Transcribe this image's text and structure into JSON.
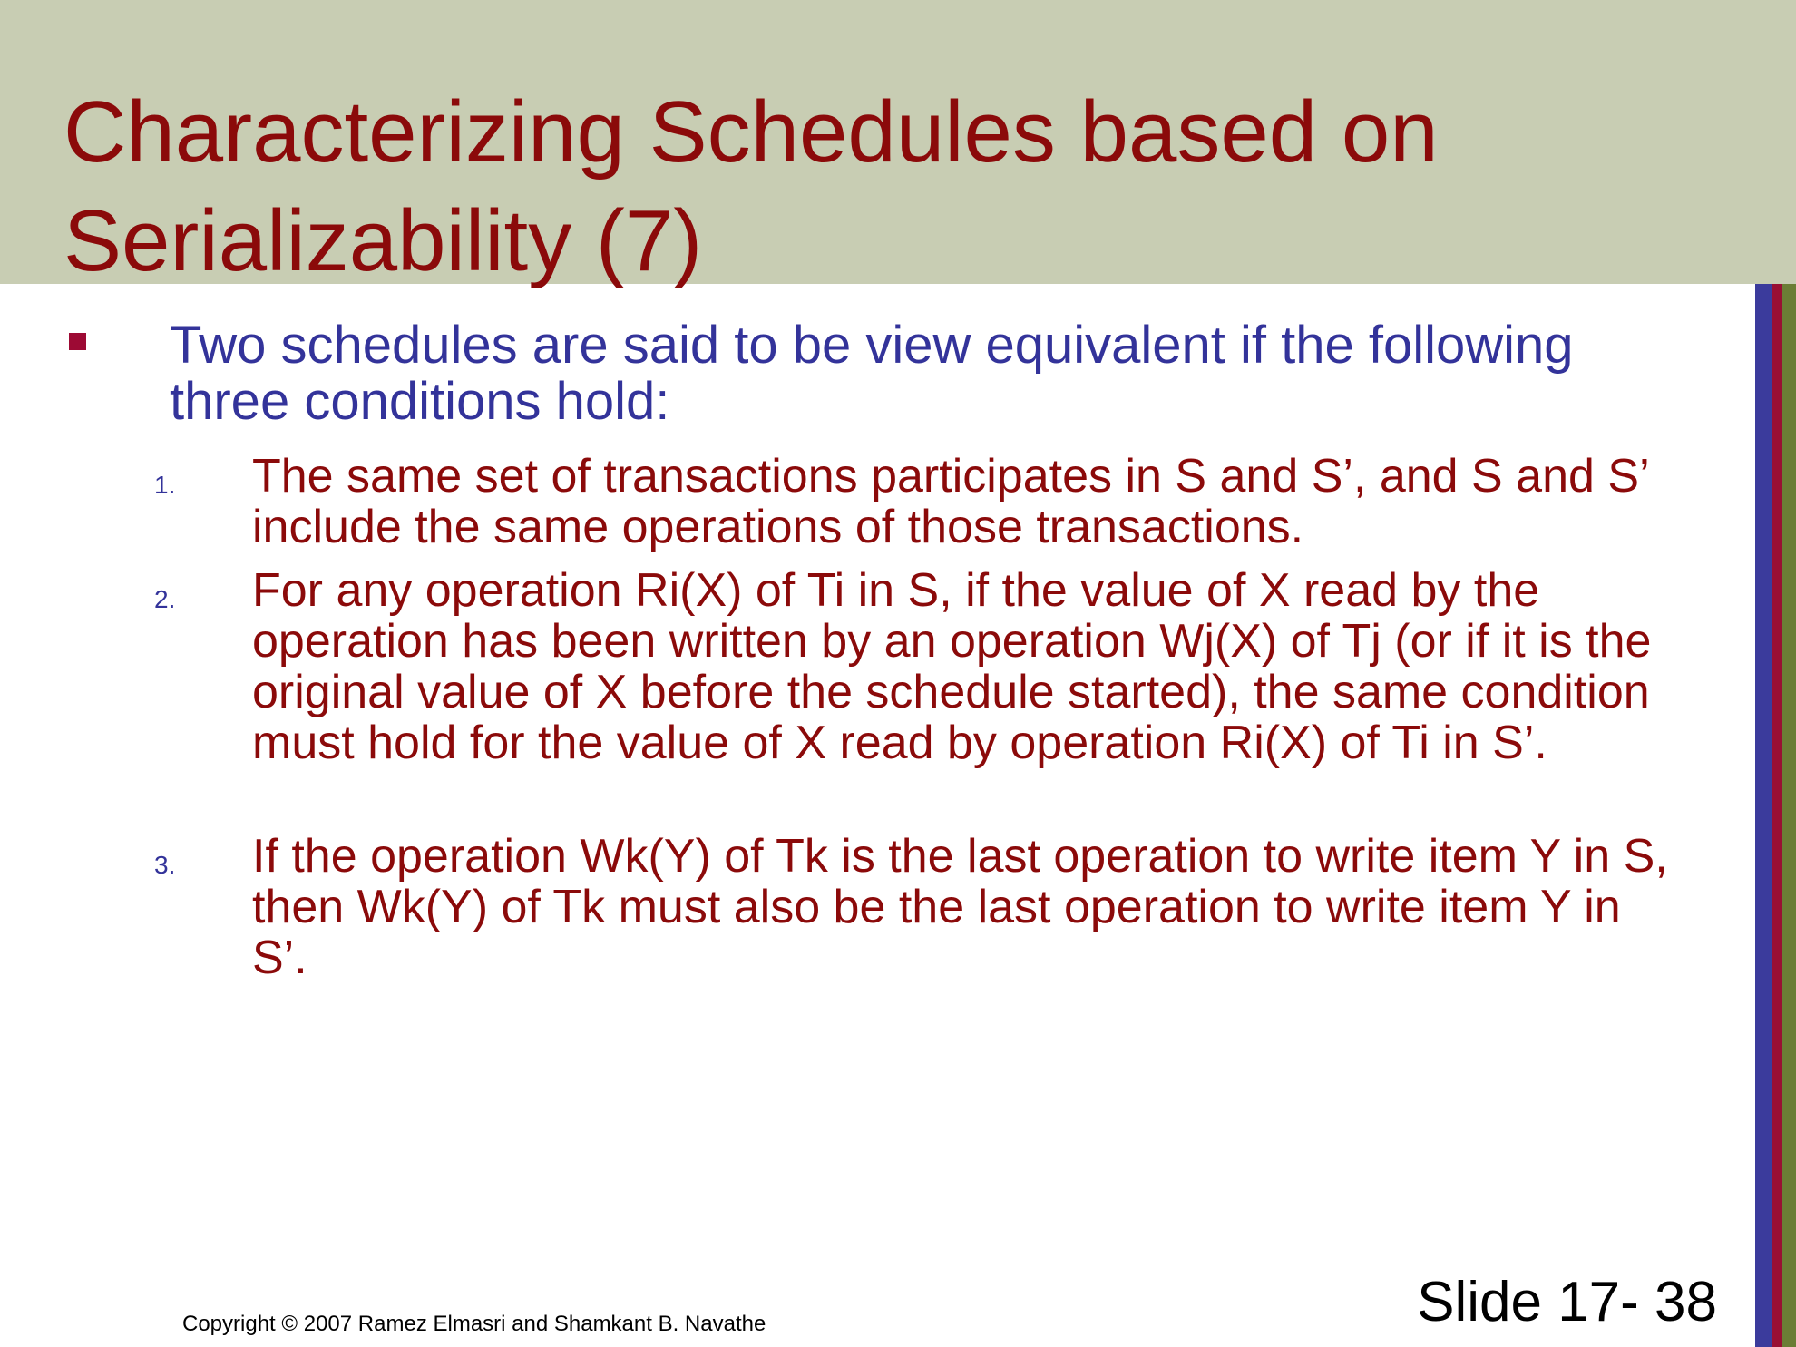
{
  "slide": {
    "title": "Characterizing Schedules based on Serializability (7)",
    "bullet": "Two schedules are said to be view equivalent if the following three conditions hold:",
    "conditions": [
      {
        "number": "1.",
        "text": "The same set of transactions participates in S and S’, and S and S’ include the same operations of those transactions."
      },
      {
        "number": "2.",
        "text": "For any operation Ri(X) of Ti in S, if the value of X read by the operation has been written by an operation Wj(X) of Tj (or if it is the original value of X before the schedule started), the same condition must hold for the value of X read by operation Ri(X) of Ti in S’."
      },
      {
        "number": "3.",
        "text": "If the operation Wk(Y) of Tk is the last operation to write item Y in S, then Wk(Y) of Tk must also be the last operation to write item Y in S’."
      }
    ]
  },
  "footer": {
    "copyright": "Copyright © 2007 Ramez Elmasri and Shamkant B. Navathe",
    "slide_number": "Slide 17- 38"
  },
  "colors": {
    "title_band": "#c8cdb3",
    "title_text": "#8b0a0a",
    "bullet_text": "#33339a",
    "bullet_marker": "#9d0a34",
    "stripe_blue": "#3b3b9c",
    "stripe_red": "#990f33",
    "stripe_green": "#6b7d35"
  }
}
